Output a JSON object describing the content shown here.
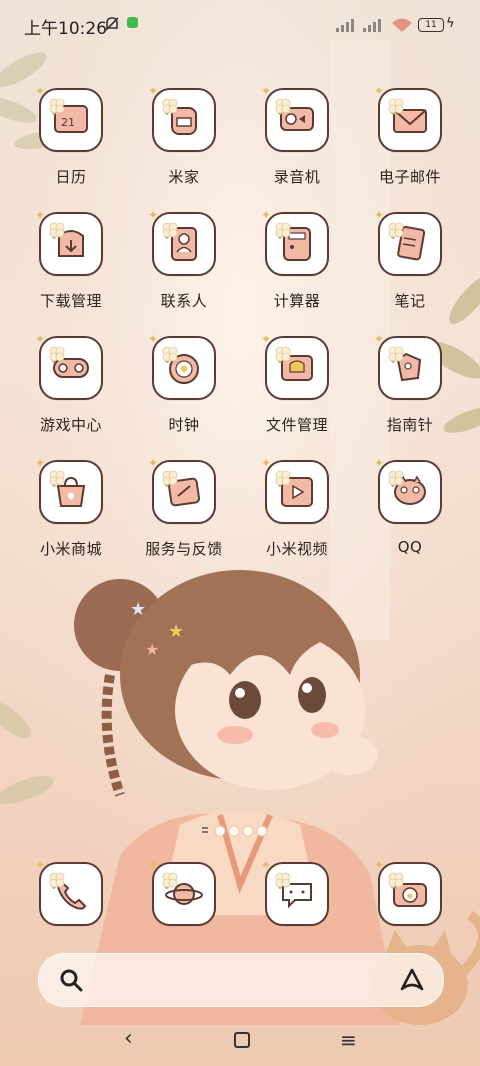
{
  "status_bar": {
    "time": "上午10:26",
    "battery": "11"
  },
  "apps": [
    {
      "label": "日历",
      "icon": "calendar-icon"
    },
    {
      "label": "米家",
      "icon": "backpack-icon"
    },
    {
      "label": "录音机",
      "icon": "recorder-icon"
    },
    {
      "label": "电子邮件",
      "icon": "mail-icon"
    },
    {
      "label": "下载管理",
      "icon": "download-icon"
    },
    {
      "label": "联系人",
      "icon": "contacts-icon"
    },
    {
      "label": "计算器",
      "icon": "calculator-icon"
    },
    {
      "label": "笔记",
      "icon": "notes-icon"
    },
    {
      "label": "游戏中心",
      "icon": "gamepad-icon"
    },
    {
      "label": "时钟",
      "icon": "clock-icon"
    },
    {
      "label": "文件管理",
      "icon": "folder-icon"
    },
    {
      "label": "指南针",
      "icon": "compass-icon"
    },
    {
      "label": "小米商城",
      "icon": "shopping-bag-icon"
    },
    {
      "label": "服务与反馈",
      "icon": "feedback-icon"
    },
    {
      "label": "小米视频",
      "icon": "video-icon"
    },
    {
      "label": "QQ",
      "icon": "qq-icon"
    }
  ],
  "dock": [
    {
      "icon": "phone-icon"
    },
    {
      "icon": "planet-icon"
    },
    {
      "icon": "chat-icon"
    },
    {
      "icon": "camera-icon"
    }
  ],
  "colors": {
    "accent": "#e9a58d",
    "tile_border": "#5a3a33",
    "icon_fill": "#f2b9a6"
  }
}
